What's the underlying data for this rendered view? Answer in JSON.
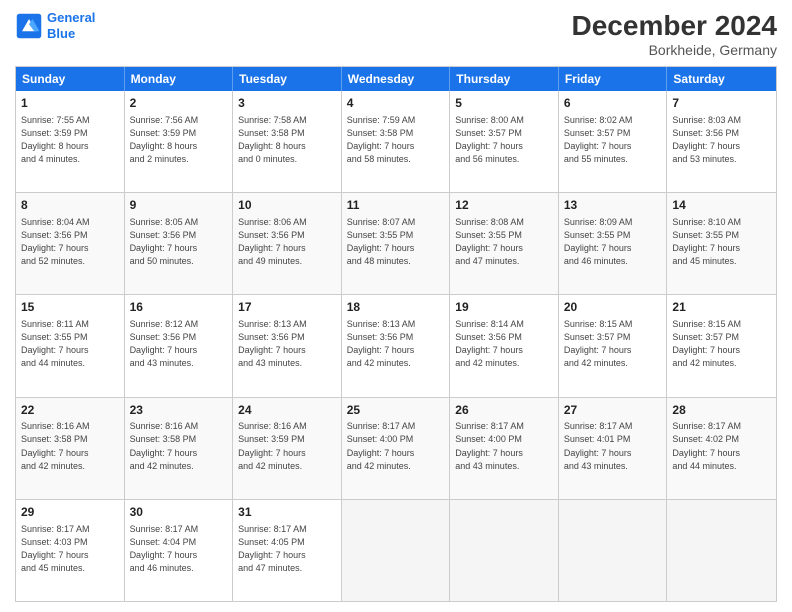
{
  "header": {
    "logo_line1": "General",
    "logo_line2": "Blue",
    "month": "December 2024",
    "location": "Borkheide, Germany"
  },
  "days_of_week": [
    "Sunday",
    "Monday",
    "Tuesday",
    "Wednesday",
    "Thursday",
    "Friday",
    "Saturday"
  ],
  "weeks": [
    [
      {
        "day": "1",
        "info": "Sunrise: 7:55 AM\nSunset: 3:59 PM\nDaylight: 8 hours\nand 4 minutes."
      },
      {
        "day": "2",
        "info": "Sunrise: 7:56 AM\nSunset: 3:59 PM\nDaylight: 8 hours\nand 2 minutes."
      },
      {
        "day": "3",
        "info": "Sunrise: 7:58 AM\nSunset: 3:58 PM\nDaylight: 8 hours\nand 0 minutes."
      },
      {
        "day": "4",
        "info": "Sunrise: 7:59 AM\nSunset: 3:58 PM\nDaylight: 7 hours\nand 58 minutes."
      },
      {
        "day": "5",
        "info": "Sunrise: 8:00 AM\nSunset: 3:57 PM\nDaylight: 7 hours\nand 56 minutes."
      },
      {
        "day": "6",
        "info": "Sunrise: 8:02 AM\nSunset: 3:57 PM\nDaylight: 7 hours\nand 55 minutes."
      },
      {
        "day": "7",
        "info": "Sunrise: 8:03 AM\nSunset: 3:56 PM\nDaylight: 7 hours\nand 53 minutes."
      }
    ],
    [
      {
        "day": "8",
        "info": "Sunrise: 8:04 AM\nSunset: 3:56 PM\nDaylight: 7 hours\nand 52 minutes."
      },
      {
        "day": "9",
        "info": "Sunrise: 8:05 AM\nSunset: 3:56 PM\nDaylight: 7 hours\nand 50 minutes."
      },
      {
        "day": "10",
        "info": "Sunrise: 8:06 AM\nSunset: 3:56 PM\nDaylight: 7 hours\nand 49 minutes."
      },
      {
        "day": "11",
        "info": "Sunrise: 8:07 AM\nSunset: 3:55 PM\nDaylight: 7 hours\nand 48 minutes."
      },
      {
        "day": "12",
        "info": "Sunrise: 8:08 AM\nSunset: 3:55 PM\nDaylight: 7 hours\nand 47 minutes."
      },
      {
        "day": "13",
        "info": "Sunrise: 8:09 AM\nSunset: 3:55 PM\nDaylight: 7 hours\nand 46 minutes."
      },
      {
        "day": "14",
        "info": "Sunrise: 8:10 AM\nSunset: 3:55 PM\nDaylight: 7 hours\nand 45 minutes."
      }
    ],
    [
      {
        "day": "15",
        "info": "Sunrise: 8:11 AM\nSunset: 3:55 PM\nDaylight: 7 hours\nand 44 minutes."
      },
      {
        "day": "16",
        "info": "Sunrise: 8:12 AM\nSunset: 3:56 PM\nDaylight: 7 hours\nand 43 minutes."
      },
      {
        "day": "17",
        "info": "Sunrise: 8:13 AM\nSunset: 3:56 PM\nDaylight: 7 hours\nand 43 minutes."
      },
      {
        "day": "18",
        "info": "Sunrise: 8:13 AM\nSunset: 3:56 PM\nDaylight: 7 hours\nand 42 minutes."
      },
      {
        "day": "19",
        "info": "Sunrise: 8:14 AM\nSunset: 3:56 PM\nDaylight: 7 hours\nand 42 minutes."
      },
      {
        "day": "20",
        "info": "Sunrise: 8:15 AM\nSunset: 3:57 PM\nDaylight: 7 hours\nand 42 minutes."
      },
      {
        "day": "21",
        "info": "Sunrise: 8:15 AM\nSunset: 3:57 PM\nDaylight: 7 hours\nand 42 minutes."
      }
    ],
    [
      {
        "day": "22",
        "info": "Sunrise: 8:16 AM\nSunset: 3:58 PM\nDaylight: 7 hours\nand 42 minutes."
      },
      {
        "day": "23",
        "info": "Sunrise: 8:16 AM\nSunset: 3:58 PM\nDaylight: 7 hours\nand 42 minutes."
      },
      {
        "day": "24",
        "info": "Sunrise: 8:16 AM\nSunset: 3:59 PM\nDaylight: 7 hours\nand 42 minutes."
      },
      {
        "day": "25",
        "info": "Sunrise: 8:17 AM\nSunset: 4:00 PM\nDaylight: 7 hours\nand 42 minutes."
      },
      {
        "day": "26",
        "info": "Sunrise: 8:17 AM\nSunset: 4:00 PM\nDaylight: 7 hours\nand 43 minutes."
      },
      {
        "day": "27",
        "info": "Sunrise: 8:17 AM\nSunset: 4:01 PM\nDaylight: 7 hours\nand 43 minutes."
      },
      {
        "day": "28",
        "info": "Sunrise: 8:17 AM\nSunset: 4:02 PM\nDaylight: 7 hours\nand 44 minutes."
      }
    ],
    [
      {
        "day": "29",
        "info": "Sunrise: 8:17 AM\nSunset: 4:03 PM\nDaylight: 7 hours\nand 45 minutes."
      },
      {
        "day": "30",
        "info": "Sunrise: 8:17 AM\nSunset: 4:04 PM\nDaylight: 7 hours\nand 46 minutes."
      },
      {
        "day": "31",
        "info": "Sunrise: 8:17 AM\nSunset: 4:05 PM\nDaylight: 7 hours\nand 47 minutes."
      },
      {
        "day": "",
        "info": ""
      },
      {
        "day": "",
        "info": ""
      },
      {
        "day": "",
        "info": ""
      },
      {
        "day": "",
        "info": ""
      }
    ]
  ]
}
